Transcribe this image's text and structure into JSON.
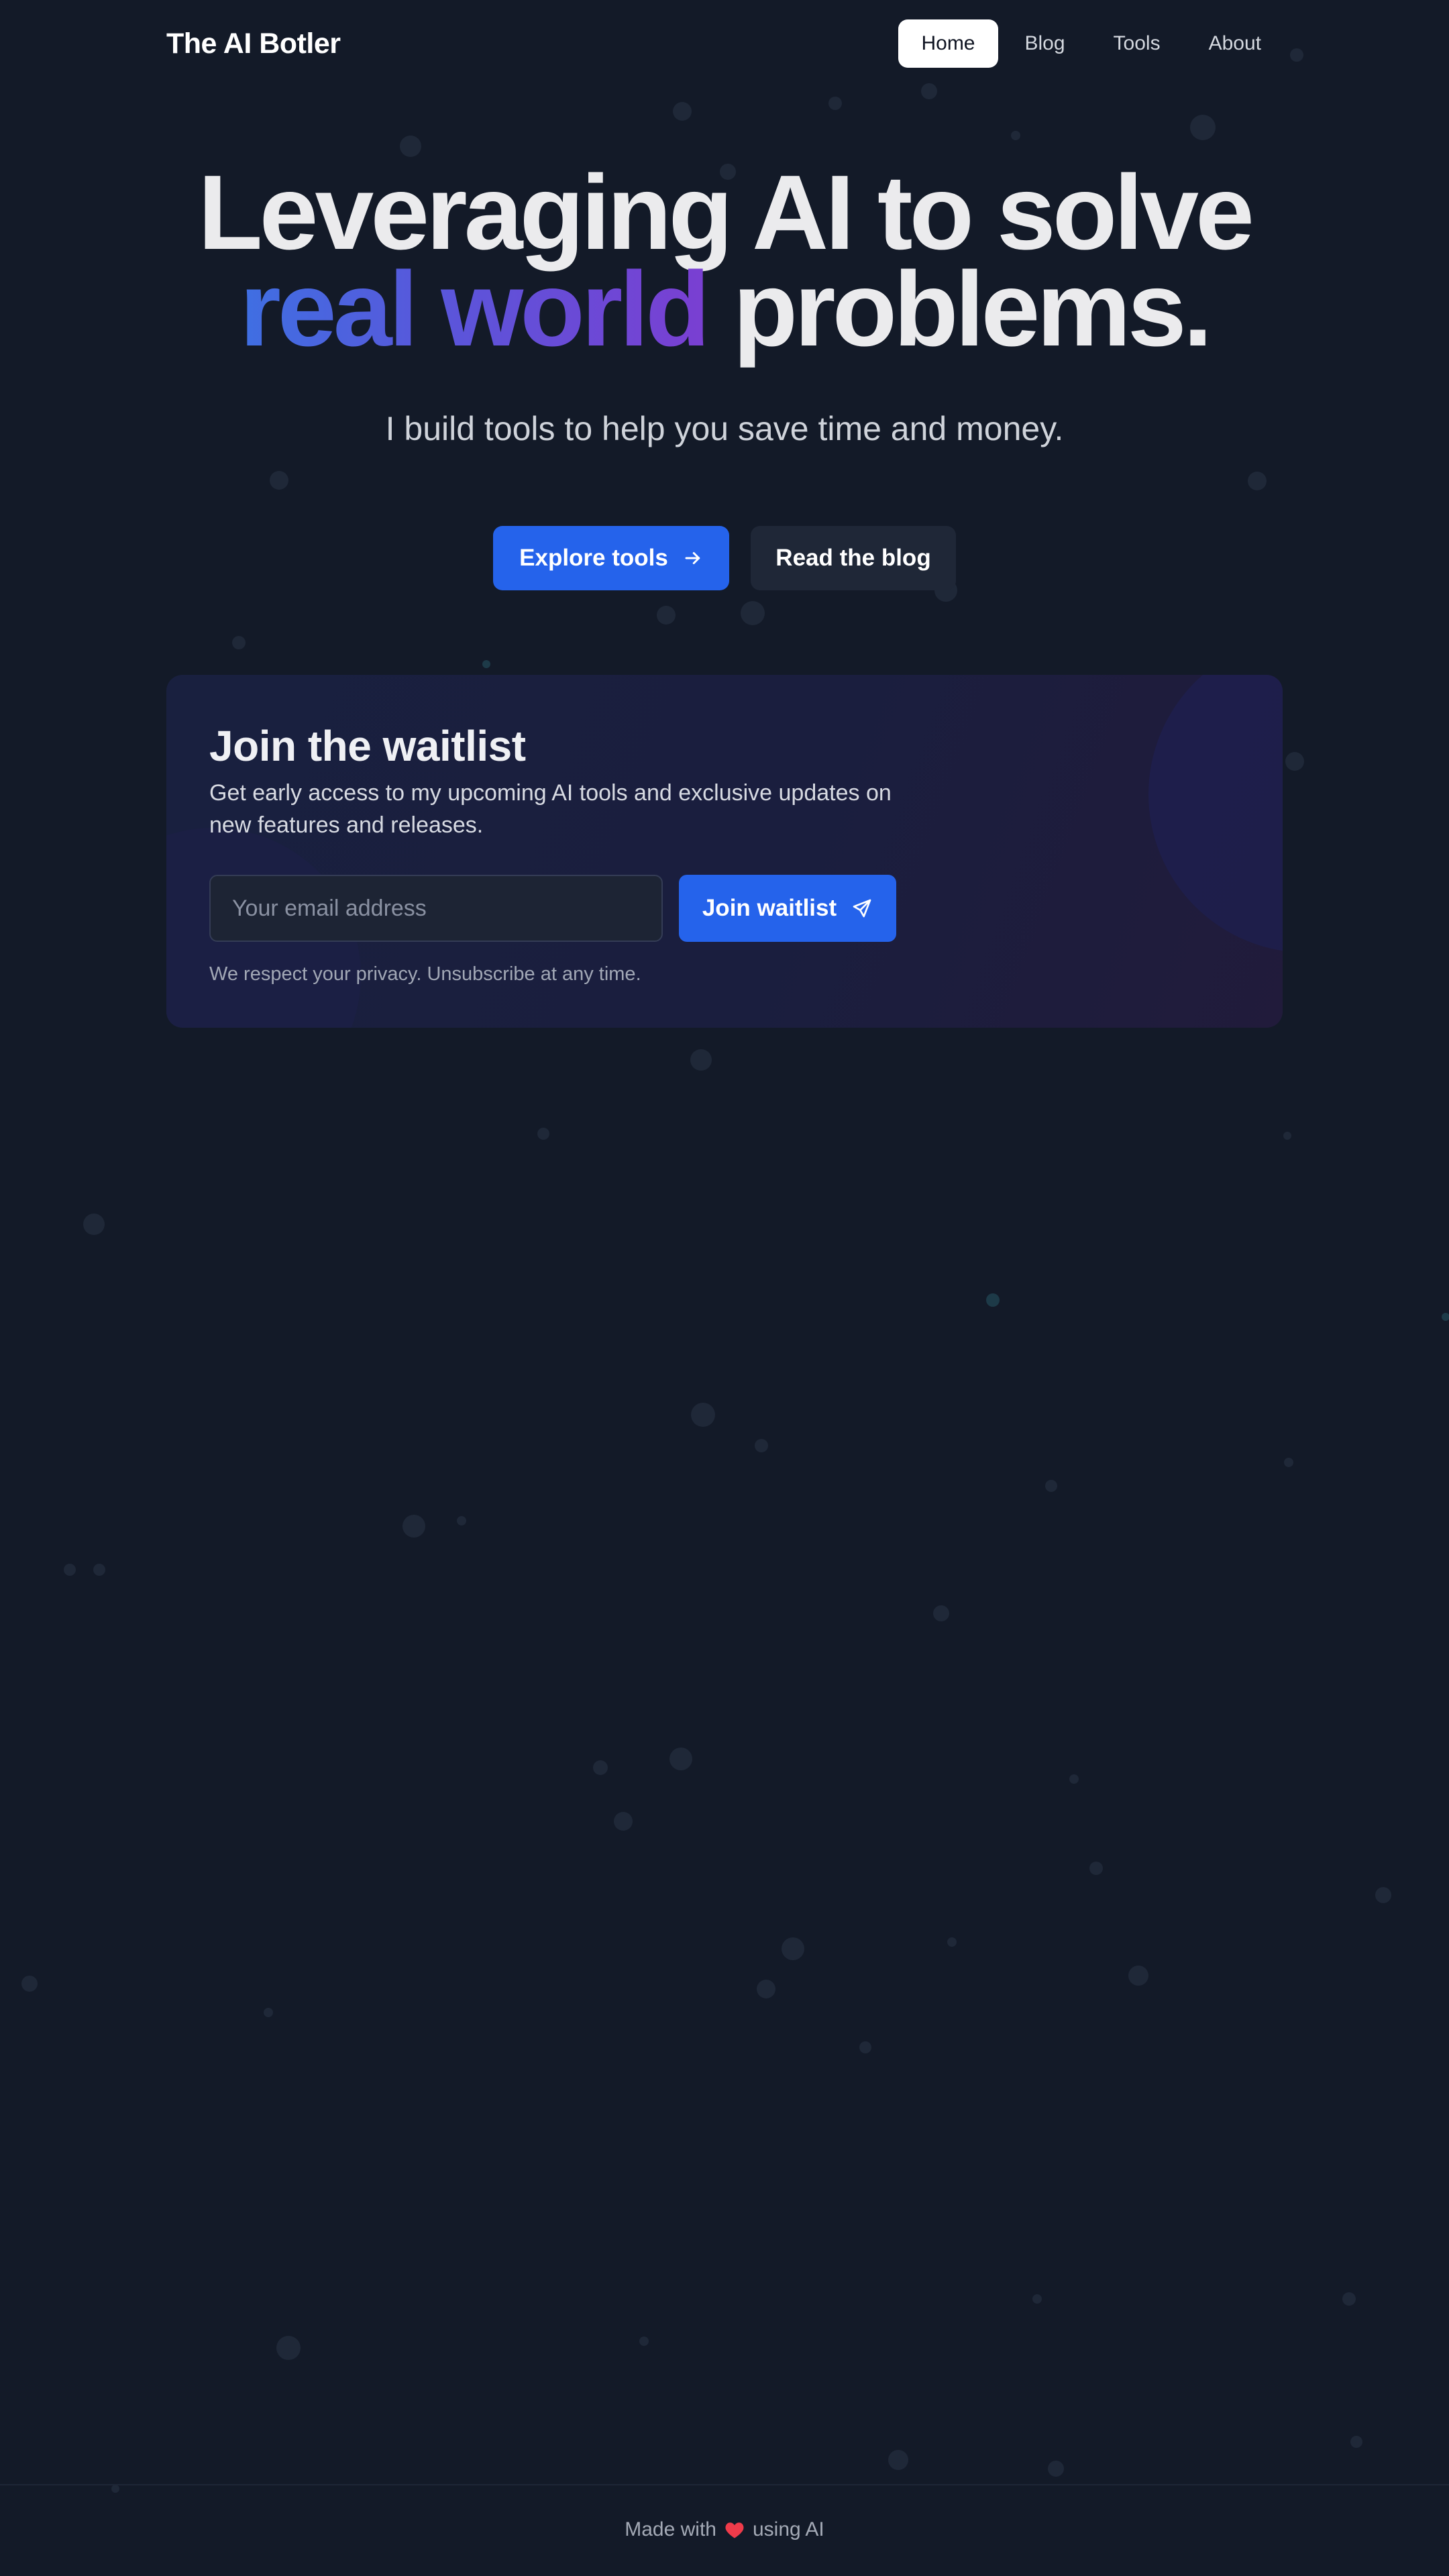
{
  "nav": {
    "brand": "The AI Botler",
    "links": [
      {
        "label": "Home",
        "active": true
      },
      {
        "label": "Blog",
        "active": false
      },
      {
        "label": "Tools",
        "active": false
      },
      {
        "label": "About",
        "active": false
      }
    ]
  },
  "hero": {
    "title_line1": "Leveraging AI to solve",
    "title_highlight": "real world",
    "title_rest": "problems.",
    "subtitle": "I build tools to help you save time and money.",
    "primary_button": {
      "label": "Explore tools",
      "icon": "arrow-right-icon"
    },
    "secondary_button": {
      "label": "Read the blog"
    }
  },
  "waitlist": {
    "title": "Join the waitlist",
    "description": "Get early access to my upcoming AI tools and exclusive updates on new features and releases.",
    "email_placeholder": "Your email address",
    "email_value": "",
    "submit_label": "Join waitlist",
    "submit_icon": "send-icon",
    "privacy_note": "We respect your privacy. Unsubscribe at any time."
  },
  "footer": {
    "prefix": "Made with",
    "icon": "heart-icon",
    "suffix": "using AI"
  },
  "colors": {
    "background": "#131a28",
    "accent": "#2563eb",
    "gradient_start": "#3f6fe2",
    "gradient_end": "#7a3fd2",
    "heart": "#ef3b4a"
  }
}
